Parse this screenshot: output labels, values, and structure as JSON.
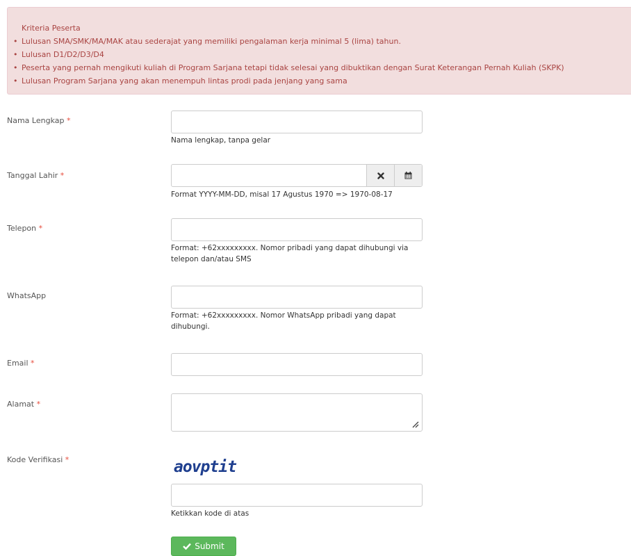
{
  "alert": {
    "title": "Kriteria Peserta",
    "items": [
      "Lulusan SMA/SMK/MA/MAK atau sederajat yang memiliki pengalaman kerja minimal 5 (lima) tahun.",
      "Lulusan D1/D2/D3/D4",
      "Peserta yang pernah mengikuti kuliah di Program Sarjana tetapi tidak selesai yang dibuktikan dengan Surat Keterangan Pernah Kuliah (SKPK)",
      "Lulusan Program Sarjana yang akan menempuh lintas prodi pada jenjang yang sama"
    ]
  },
  "form": {
    "required_mark": "*",
    "nama": {
      "label": "Nama Lengkap",
      "value": "",
      "help": "Nama lengkap, tanpa gelar"
    },
    "tanggal": {
      "label": "Tanggal Lahir",
      "value": "",
      "help": "Format YYYY-MM-DD, misal 17 Agustus 1970 => 1970-08-17",
      "clear_icon": "times-icon",
      "calendar_icon": "calendar-icon"
    },
    "telepon": {
      "label": "Telepon",
      "value": "",
      "help": "Format: +62xxxxxxxxx. Nomor pribadi yang dapat dihubungi via telepon dan/atau SMS"
    },
    "whatsapp": {
      "label": "WhatsApp",
      "value": "",
      "help": "Format: +62xxxxxxxxx. Nomor WhatsApp pribadi yang dapat dihubungi."
    },
    "email": {
      "label": "Email",
      "value": ""
    },
    "alamat": {
      "label": "Alamat",
      "value": ""
    },
    "kode": {
      "label": "Kode Verifikasi",
      "captcha_text": "aovptit",
      "value": "",
      "help": "Ketikkan kode di atas"
    },
    "submit_label": "Submit"
  },
  "colors": {
    "alert_bg": "#f2dede",
    "alert_text": "#a94442",
    "required": "#e74c3c",
    "submit_bg": "#5cb85c",
    "captcha": "#1f3f8f"
  }
}
